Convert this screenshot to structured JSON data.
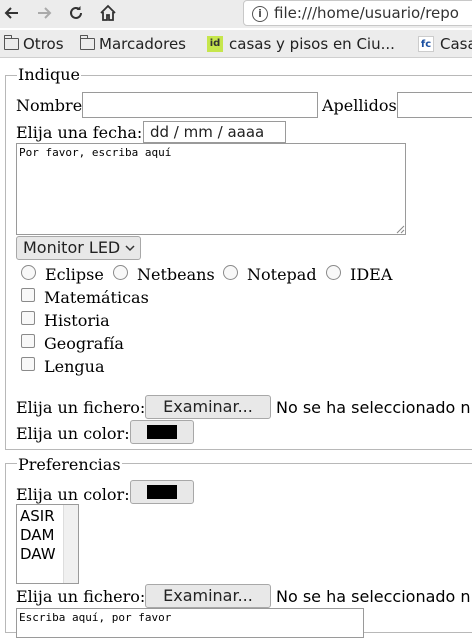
{
  "browser": {
    "url": "file:///home/usuario/repo",
    "bookmarks": [
      {
        "label": "Otros",
        "icon": "folder-icon"
      },
      {
        "label": "Marcadores",
        "icon": "folder-icon"
      },
      {
        "label": "casas y pisos en Ciu...",
        "icon": "id-favicon",
        "badge": "id"
      },
      {
        "label": "Casa",
        "icon": "fc-favicon",
        "badge": "fc"
      }
    ]
  },
  "form1": {
    "legend": "Indique",
    "nombre_label": "Nombre",
    "apellidos_label": "Apellidos",
    "fecha_label": "Elija una fecha:",
    "fecha_placeholder": "dd / mm / aaaa",
    "textarea_text": "Por favor, escriba aquí",
    "select_value": "Monitor LED",
    "radios": [
      "Eclipse",
      "Netbeans",
      "Notepad",
      "IDEA"
    ],
    "checkboxes": [
      "Matemáticas",
      "Historia",
      "Geografía",
      "Lengua"
    ],
    "fichero_label": "Elija un fichero:",
    "fichero_button": "Examinar...",
    "fichero_status": "No se ha seleccionado ni",
    "color_label": "Elija un color:",
    "color_value": "#000000"
  },
  "form2": {
    "legend": "Preferencias",
    "color_label": "Elija un color:",
    "color_value": "#000000",
    "list_options": [
      "ASIR",
      "DAM",
      "DAW"
    ],
    "fichero_label": "Elija un fichero:",
    "fichero_button": "Examinar...",
    "fichero_status": "No se ha seleccionado ni",
    "textarea_text": "Escriba aquí, por favor"
  }
}
